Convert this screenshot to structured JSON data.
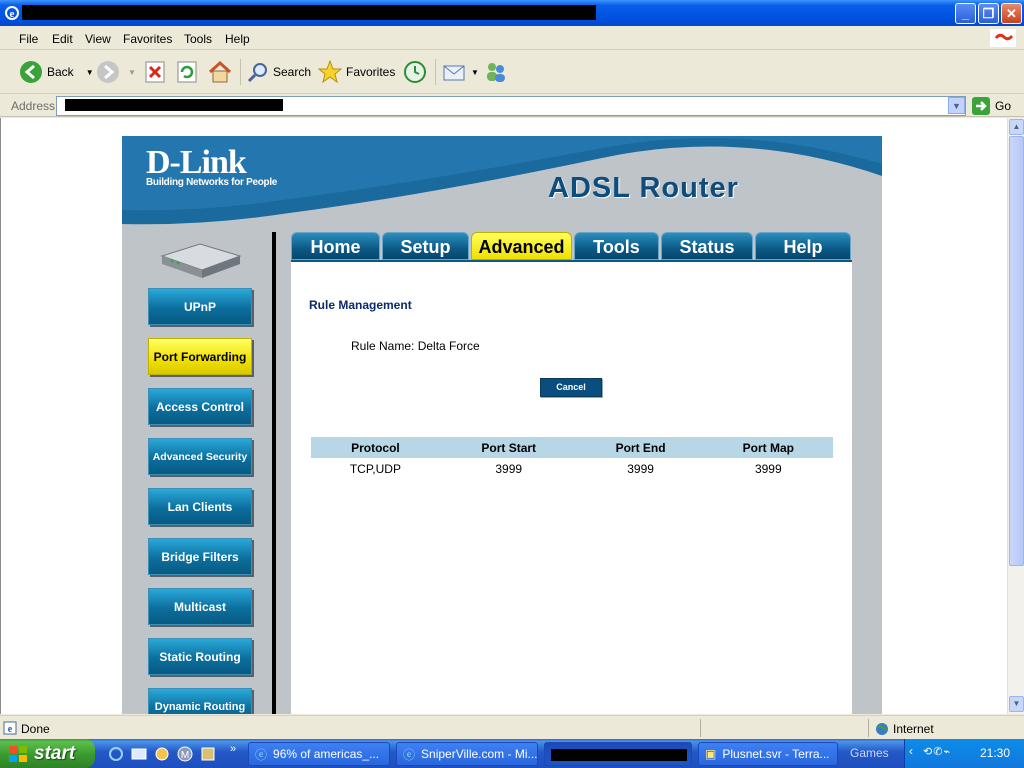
{
  "browser": {
    "menu": [
      "File",
      "Edit",
      "View",
      "Favorites",
      "Tools",
      "Help"
    ],
    "toolbar": {
      "back": "Back",
      "search": "Search",
      "favorites": "Favorites"
    },
    "address_label": "Address",
    "go_label": "Go",
    "status_text": "Done",
    "zone_text": "Internet"
  },
  "page": {
    "brand": "D-Link",
    "tagline": "Building Networks for People",
    "product": "ADSL Router",
    "tabs": [
      "Home",
      "Setup",
      "Advanced",
      "Tools",
      "Status",
      "Help"
    ],
    "active_tab": "Advanced",
    "sidebar": [
      {
        "label": "UPnP",
        "active": false
      },
      {
        "label": "Port Forwarding",
        "active": true
      },
      {
        "label": "Access Control",
        "active": false
      },
      {
        "label": "Advanced Security",
        "active": false
      },
      {
        "label": "Lan Clients",
        "active": false
      },
      {
        "label": "Bridge Filters",
        "active": false
      },
      {
        "label": "Multicast",
        "active": false
      },
      {
        "label": "Static Routing",
        "active": false
      },
      {
        "label": "Dynamic Routing",
        "active": false
      }
    ],
    "section_title": "Rule Management",
    "rule_name": "Rule Name: Delta Force",
    "cancel_label": "Cancel",
    "table": {
      "headers": [
        "Protocol",
        "Port Start",
        "Port End",
        "Port Map"
      ],
      "rows": [
        [
          "TCP,UDP",
          "3999",
          "3999",
          "3999"
        ]
      ]
    }
  },
  "taskbar": {
    "start_label": "start",
    "tasks": [
      "96% of americas_...",
      "SniperVille.com - Mi...",
      "",
      "Plusnet.svr - Terra..."
    ],
    "group_label": "Games",
    "clock": "21:30"
  },
  "colors": {
    "xp_blue": "#0054E3",
    "dlink_blue": "#0B5A86",
    "active_yellow": "#F0E000",
    "table_header": "#B7D6E6"
  }
}
